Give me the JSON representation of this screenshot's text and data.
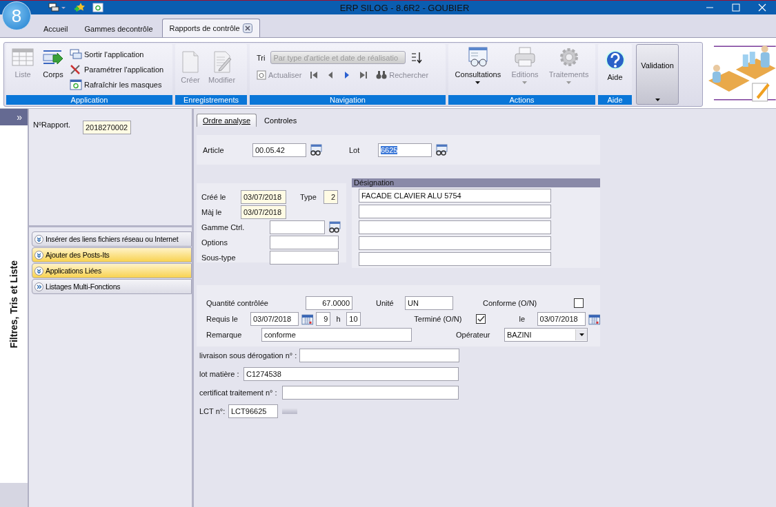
{
  "window": {
    "logo_text": "8",
    "title": "ERP SILOG - 8.6R2 - GOUBIER"
  },
  "tabs": [
    {
      "label": "Accueil",
      "selected": false,
      "closable": false
    },
    {
      "label": "Gammes decontrôle",
      "selected": false,
      "closable": false
    },
    {
      "label": "Rapports de contrôle",
      "selected": true,
      "closable": true
    }
  ],
  "ribbon": {
    "application": {
      "title": "Application",
      "large_buttons": [
        {
          "label": "Liste",
          "disabled": true
        },
        {
          "label": "Corps",
          "disabled": false
        }
      ],
      "commands": [
        {
          "label": "Sortir l'application"
        },
        {
          "label": "Paramétrer l'application"
        },
        {
          "label": "Rafraîchir les masques"
        }
      ]
    },
    "records": {
      "title": "Enregistrements",
      "buttons": [
        {
          "label": "Créer",
          "disabled": true
        },
        {
          "label": "Modifier",
          "disabled": true
        }
      ]
    },
    "navigation": {
      "title": "Navigation",
      "sort_label": "Tri",
      "sort_value": "Par type d'article et date de réalisatio",
      "refresh": {
        "label": "Actualiser",
        "disabled": true
      },
      "search": {
        "label": "Rechercher",
        "disabled": true
      }
    },
    "actions": {
      "title": "Actions",
      "buttons": [
        {
          "label": "Consultations",
          "disabled": false
        },
        {
          "label": "Editions",
          "disabled": true
        },
        {
          "label": "Traitements",
          "disabled": true
        }
      ]
    },
    "help": {
      "title": "Aide",
      "button": "Aide"
    },
    "validation": {
      "label": "Validation"
    }
  },
  "sidebar": {
    "toggle": "»",
    "title": "Filtres, Tris et Liste"
  },
  "left_panel": {
    "report": {
      "label": "NºRapport.",
      "value": "2018270002",
      "readonly": true
    },
    "panels": [
      {
        "label": "Insérer des liens fichiers réseau ou Internet",
        "kind": "group",
        "highlighted": false
      },
      {
        "label": "Ajouter des Posts-Its",
        "kind": "group",
        "highlighted": true
      },
      {
        "label": "Applications Liées",
        "kind": "group",
        "highlighted": true
      },
      {
        "label": "Listages Multi-Fonctions",
        "kind": "launcher",
        "highlighted": false
      }
    ]
  },
  "form_tabs": [
    {
      "label": "Ordre analyse",
      "selected": true
    },
    {
      "label": "Controles",
      "selected": false
    }
  ],
  "article": {
    "label": "Article",
    "value": "00.05.42"
  },
  "lot": {
    "label": "Lot",
    "value": "6625",
    "text_selected": true
  },
  "created": {
    "label": "Créé le",
    "value": "03/07/2018",
    "readonly": true
  },
  "type": {
    "label": "Type",
    "value": "2",
    "readonly": true
  },
  "updated": {
    "label": "Màj le",
    "value": "03/07/2018",
    "readonly": true
  },
  "control_range": {
    "label": "Gamme Ctrl."
  },
  "options": {
    "label": "Options"
  },
  "subtype": {
    "label": "Sous-type"
  },
  "designation": {
    "title": "Désignation",
    "lines": [
      {
        "value": "FACADE CLAVIER ALU 5754"
      }
    ]
  },
  "quantity": {
    "label": "Quantité contrôlée",
    "value": "67.0000"
  },
  "unit": {
    "label": "Unité",
    "value": "UN"
  },
  "compliant": {
    "label": "Conforme (O/N)",
    "checked": false
  },
  "required": {
    "label": "Requis le",
    "date": "03/07/2018",
    "hour": "9",
    "separator": "h",
    "minute": "10"
  },
  "finished": {
    "label": "Terminé (O/N)",
    "checked": true,
    "date_label": "le",
    "date": "03/07/2018"
  },
  "remark": {
    "label": "Remarque",
    "value": "conforme"
  },
  "operator": {
    "label": "Opérateur",
    "value": "BAZINI"
  },
  "derogation": {
    "label": "livraison sous dérogation n° :"
  },
  "material_lot": {
    "label": "lot matière :",
    "value": "C1274538"
  },
  "certificate": {
    "label": "certificat traitement n° :"
  },
  "lct": {
    "label": "LCT n°:",
    "value": "LCT96625"
  }
}
